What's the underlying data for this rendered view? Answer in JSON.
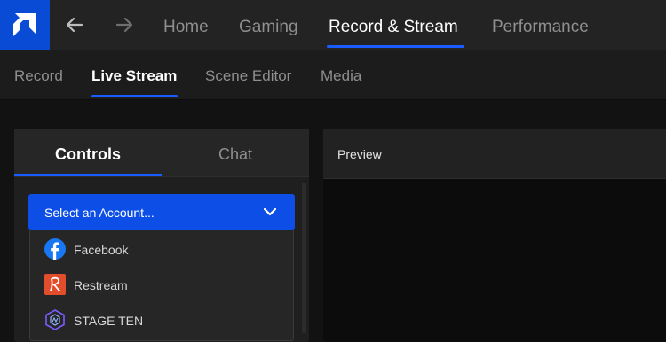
{
  "top_nav": {
    "tabs": [
      "Home",
      "Gaming",
      "Record & Stream",
      "Performance"
    ],
    "active": "Record & Stream"
  },
  "sub_nav": {
    "tabs": [
      "Record",
      "Live Stream",
      "Scene Editor",
      "Media"
    ],
    "active": "Live Stream"
  },
  "left_panel": {
    "tabs": [
      "Controls",
      "Chat"
    ],
    "active": "Controls",
    "account_select": {
      "value": "Select an Account...",
      "options": [
        {
          "label": "Facebook",
          "icon": "facebook-icon"
        },
        {
          "label": "Restream",
          "icon": "restream-icon"
        },
        {
          "label": "STAGE TEN",
          "icon": "stage-ten-icon"
        }
      ]
    }
  },
  "preview": {
    "title": "Preview"
  },
  "colors": {
    "accent": "#1a5cff",
    "select_bg": "#0d4fe6",
    "brand_logo_bg": "#0a4bd6",
    "facebook": "#1877f2",
    "restream": "#e24e2b",
    "stage_ten": "#7a5cff"
  }
}
